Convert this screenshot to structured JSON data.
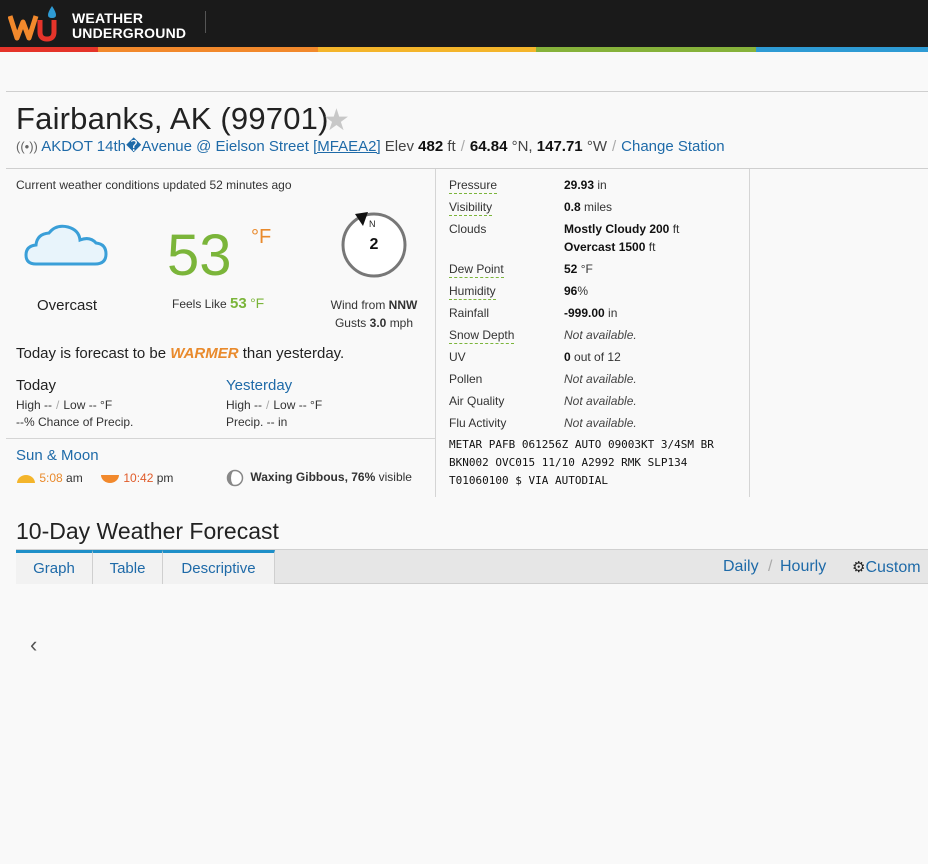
{
  "brand": {
    "line1": "WEATHER",
    "line2": "UNDERGROUND",
    "stripe_colors": [
      "#e5342a",
      "#f2892c",
      "#f4b52b",
      "#86b23b",
      "#2e9bd4"
    ]
  },
  "location": {
    "title": "Fairbanks, AK (99701)",
    "station_name": "AKDOT 14th�Avenue @ Eielson Street",
    "station_id": "[MFAEA2]",
    "elev_label": "Elev",
    "elev_value": "482",
    "elev_unit": "ft",
    "lat": "64.84",
    "lat_unit": "°N,",
    "lon": "147.71",
    "lon_unit": "°W",
    "change_station": "Change Station"
  },
  "current": {
    "updated_prefix": "Current weather conditions updated",
    "updated_ago": "52 minutes ago",
    "condition": "Overcast",
    "temperature": "53",
    "temp_unit": "°F",
    "feels_like_label": "Feels Like",
    "feels_like_value": "53",
    "feels_like_unit": "°F",
    "wind_dir_letter": "N",
    "wind_speed": "2",
    "wind_from_label": "Wind from",
    "wind_from_dir": "NNW",
    "gusts_label": "Gusts",
    "gusts_value": "3.0",
    "gusts_unit": "mph"
  },
  "forecast_text": {
    "prefix": "Today is forecast to be",
    "highlight": "WARMER",
    "suffix": "than yesterday."
  },
  "today": {
    "heading": "Today",
    "high": "High --",
    "low": "Low -- °F",
    "precip": "--% Chance of Precip."
  },
  "yesterday": {
    "heading": "Yesterday",
    "high": "High --",
    "low": "Low -- °F",
    "precip": "Precip. -- in"
  },
  "sun_moon": {
    "heading": "Sun & Moon",
    "sunrise_time": "5:08",
    "sunrise_ampm": "am",
    "sunset_time": "10:42",
    "sunset_ampm": "pm",
    "moon_phase": "Waxing Gibbous,",
    "moon_pct": "76%",
    "moon_visible": "visible"
  },
  "details": {
    "pressure_label": "Pressure",
    "pressure_value": "29.93",
    "pressure_unit": "in",
    "visibility_label": "Visibility",
    "visibility_value": "0.8",
    "visibility_unit": "miles",
    "clouds_label": "Clouds",
    "clouds_1": "Mostly Cloudy 200",
    "clouds_1_unit": "ft",
    "clouds_2": "Overcast 1500",
    "clouds_2_unit": "ft",
    "dew_label": "Dew Point",
    "dew_value": "52",
    "dew_unit": "°F",
    "humidity_label": "Humidity",
    "humidity_value": "96",
    "humidity_unit": "%",
    "rainfall_label": "Rainfall",
    "rainfall_value": "-999.00",
    "rainfall_unit": "in",
    "snow_label": "Snow Depth",
    "snow_value": "Not available.",
    "uv_label": "UV",
    "uv_value": "0",
    "uv_suffix": "out of 12",
    "pollen_label": "Pollen",
    "pollen_value": "Not available.",
    "air_label": "Air Quality",
    "air_value": "Not available.",
    "flu_label": "Flu Activity",
    "flu_value": "Not available.",
    "metar_1": "METAR PAFB 061256Z AUTO 09003KT 3/4SM BR",
    "metar_2": "BKN002 OVC015 11/10 A2992 RMK SLP134",
    "metar_3": "T01060100 $ VIA AUTODIAL"
  },
  "ten_day": {
    "heading": "10-Day Weather Forecast",
    "tabs": [
      "Graph",
      "Table",
      "Descriptive"
    ],
    "daily": "Daily",
    "hourly": "Hourly",
    "customize": "Custom"
  }
}
